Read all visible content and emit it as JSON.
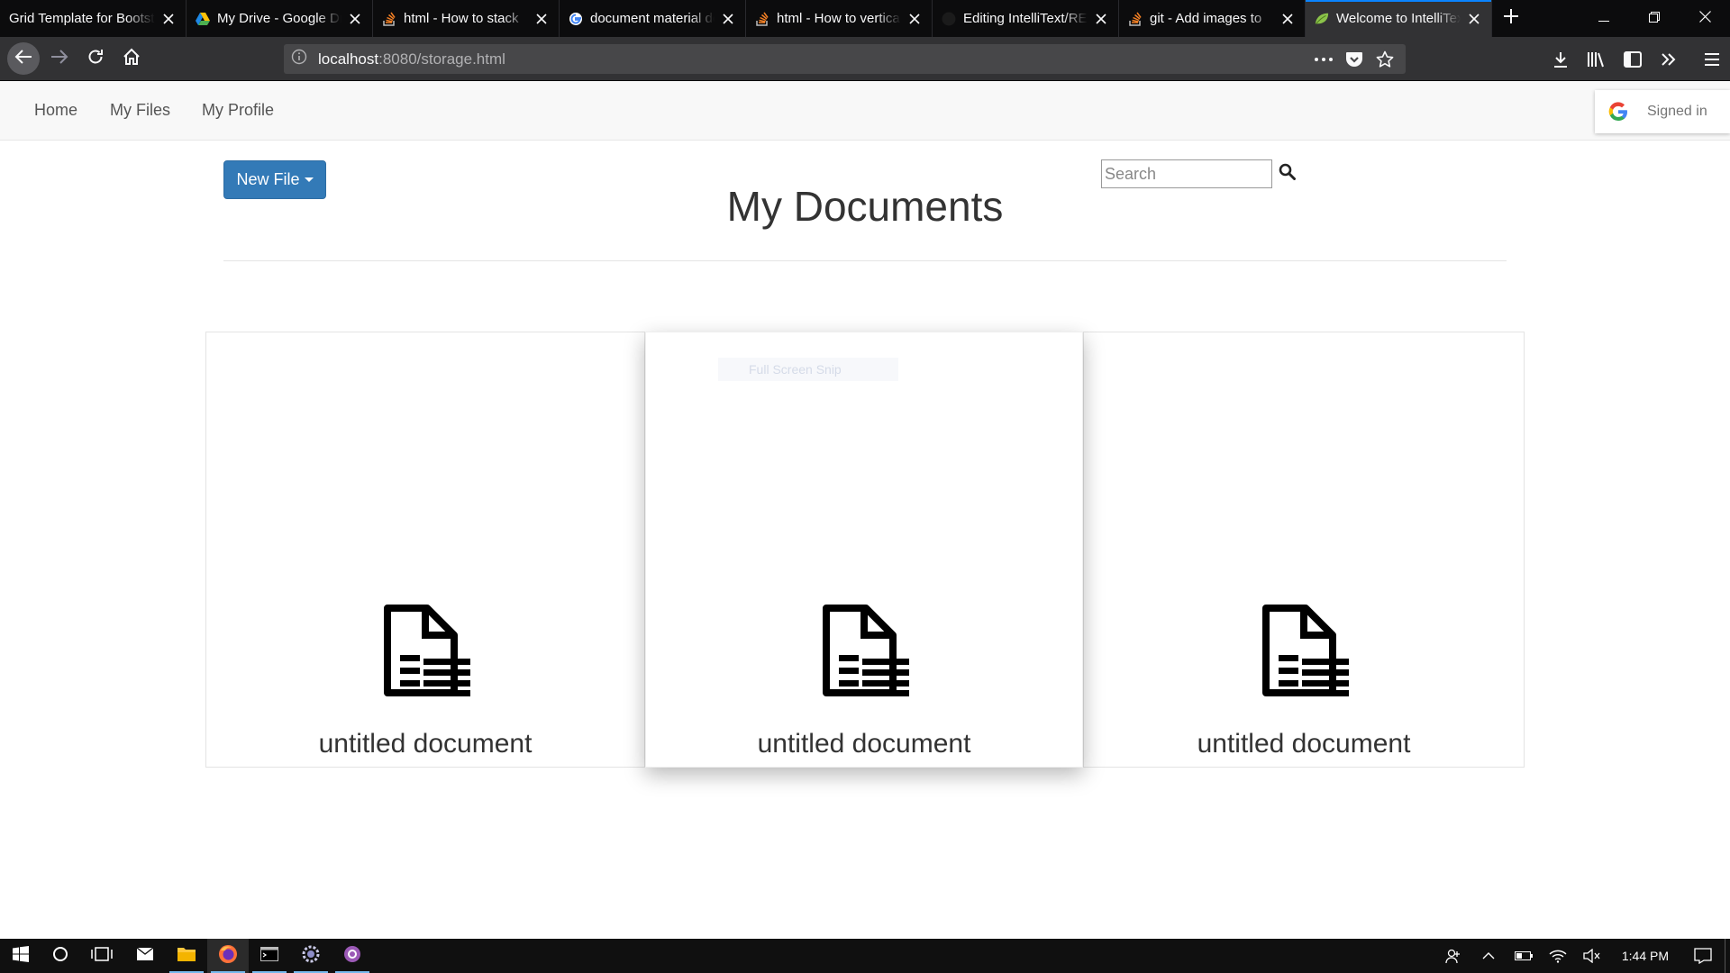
{
  "browser": {
    "tabs": [
      {
        "title": "Grid Template for Bootstrap",
        "icon": "bootstrap-icon",
        "active": false
      },
      {
        "title": "My Drive - Google Drive",
        "icon": "google-drive-icon",
        "active": false
      },
      {
        "title": "html - How to stack",
        "icon": "stackoverflow-icon",
        "active": false
      },
      {
        "title": "document material design",
        "icon": "google-icon",
        "active": false
      },
      {
        "title": "html - How to vertically",
        "icon": "stackoverflow-icon",
        "active": false
      },
      {
        "title": "Editing IntelliText/README",
        "icon": "github-icon",
        "active": false
      },
      {
        "title": "git - Add images to",
        "icon": "stackoverflow-icon",
        "active": false
      },
      {
        "title": "Welcome to IntelliText",
        "icon": "spring-leaf-icon",
        "active": true
      }
    ],
    "url": {
      "host": "localhost",
      "rest": ":8080/storage.html"
    },
    "accent": "#0a84ff"
  },
  "site": {
    "nav": {
      "home": "Home",
      "my_files": "My Files",
      "my_profile": "My Profile"
    },
    "signin_label": "Signed in",
    "new_file_label": "New File",
    "title": "My Documents",
    "search_placeholder": "Search",
    "primary_color": "#337ab7",
    "documents": [
      {
        "title": "untitled document",
        "icon": "document-icon"
      },
      {
        "title": "untitled document",
        "icon": "document-icon"
      },
      {
        "title": "untitled document",
        "icon": "document-icon"
      }
    ],
    "ghost_tooltip": "Full Screen Snip"
  },
  "taskbar": {
    "apps": [
      "windows-start-icon",
      "cortana-icon",
      "task-view-icon",
      "mail-icon",
      "file-explorer-icon",
      "firefox-icon",
      "terminal-icon",
      "settings-app-icon",
      "media-app-icon"
    ],
    "clock": "1:44 PM"
  }
}
